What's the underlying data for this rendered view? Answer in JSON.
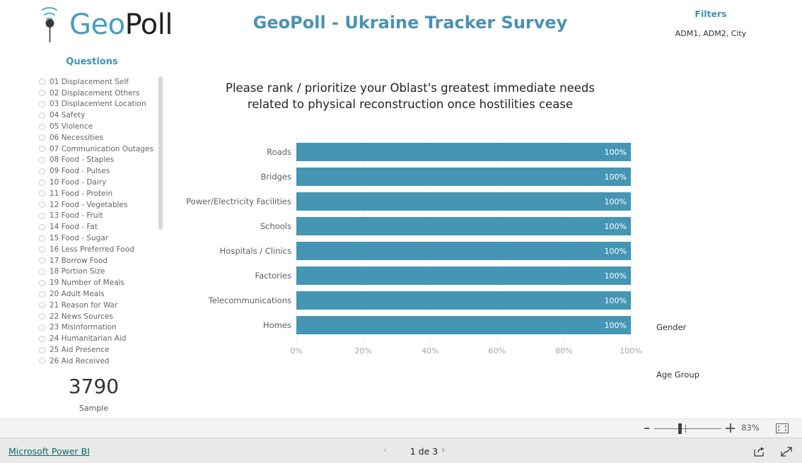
{
  "logo": {
    "text_primary": "Geo",
    "text_secondary": "Poll",
    "icon": "antenna-signal-icon"
  },
  "header": {
    "title": "GeoPoll - Ukraine Tracker Survey"
  },
  "filters": {
    "title": "Filters",
    "value": "ADM1, ADM2, City"
  },
  "questions": {
    "title": "Questions",
    "items": [
      {
        "label": "01 Displacement Self",
        "selected": false
      },
      {
        "label": "02 Displacement Others",
        "selected": false
      },
      {
        "label": "03 Displacement Location",
        "selected": false
      },
      {
        "label": "04 Safety",
        "selected": false
      },
      {
        "label": "05 Violence",
        "selected": false
      },
      {
        "label": "06 Necessities",
        "selected": false
      },
      {
        "label": "07 Communication Outages",
        "selected": false
      },
      {
        "label": "08 Food - Staples",
        "selected": false
      },
      {
        "label": "09 Food - Pulses",
        "selected": false
      },
      {
        "label": "10 Food - Dairy",
        "selected": false
      },
      {
        "label": "11 Food - Protein",
        "selected": false
      },
      {
        "label": "12 Food - Vegetables",
        "selected": false
      },
      {
        "label": "13 Food - Fruit",
        "selected": false
      },
      {
        "label": "14 Food - Fat",
        "selected": false
      },
      {
        "label": "15 Food - Sugar",
        "selected": false
      },
      {
        "label": "16 Less Preferred Food",
        "selected": false
      },
      {
        "label": "17 Borrow Food",
        "selected": false
      },
      {
        "label": "18 Portion Size",
        "selected": false
      },
      {
        "label": "19 Number of Meals",
        "selected": false
      },
      {
        "label": "20 Adult Meals",
        "selected": false
      },
      {
        "label": "21 Reason for War",
        "selected": false
      },
      {
        "label": "22 News Sources",
        "selected": false
      },
      {
        "label": "23 Misinformation",
        "selected": false
      },
      {
        "label": "24 Humanitarian Aid",
        "selected": false
      },
      {
        "label": "25 Aid Presence",
        "selected": false
      },
      {
        "label": "26 Aid Received",
        "selected": false
      }
    ]
  },
  "sample": {
    "value": "3790",
    "label": "Sample"
  },
  "slicers": {
    "gender_label": "Gender",
    "age_group_label": "Age Group"
  },
  "chart_data": {
    "type": "bar",
    "orientation": "horizontal",
    "title": "Please rank / prioritize your Oblast's greatest immediate needs related to physical reconstruction once hostilities cease",
    "title_line1": "Please rank / prioritize your Oblast's greatest immediate needs",
    "title_line2": "related to physical reconstruction once hostilities cease",
    "categories": [
      "Roads",
      "Bridges",
      "Power/Electricity Facilities",
      "Schools",
      "Hospitals / Clinics",
      "Factories",
      "Telecommunications",
      "Homes"
    ],
    "values": [
      100,
      100,
      100,
      100,
      100,
      100,
      100,
      100
    ],
    "data_labels": [
      "100%",
      "100%",
      "100%",
      "100%",
      "100%",
      "100%",
      "100%",
      "100%"
    ],
    "xlabel": "",
    "ylabel": "",
    "xlim": [
      0,
      100
    ],
    "tick_labels": [
      "0%",
      "20%",
      "40%",
      "60%",
      "80%",
      "100%"
    ],
    "tick_values": [
      0,
      20,
      40,
      60,
      80,
      100
    ],
    "grid": true,
    "legend": false,
    "bar_color": "#4596b4",
    "data_label_color": "#ffffff"
  },
  "zoombar": {
    "minus_label": "zoom-out",
    "plus_label": "zoom-in",
    "percent": "83%",
    "fit_icon": "fit-to-page-icon"
  },
  "statusbar": {
    "brand_link": "Microsoft Power BI",
    "page_indicator": "1 de 3",
    "prev_icon": "chevron-left-icon",
    "next_icon": "chevron-right-icon",
    "share_icon": "share-icon",
    "fullscreen_icon": "fullscreen-icon"
  }
}
